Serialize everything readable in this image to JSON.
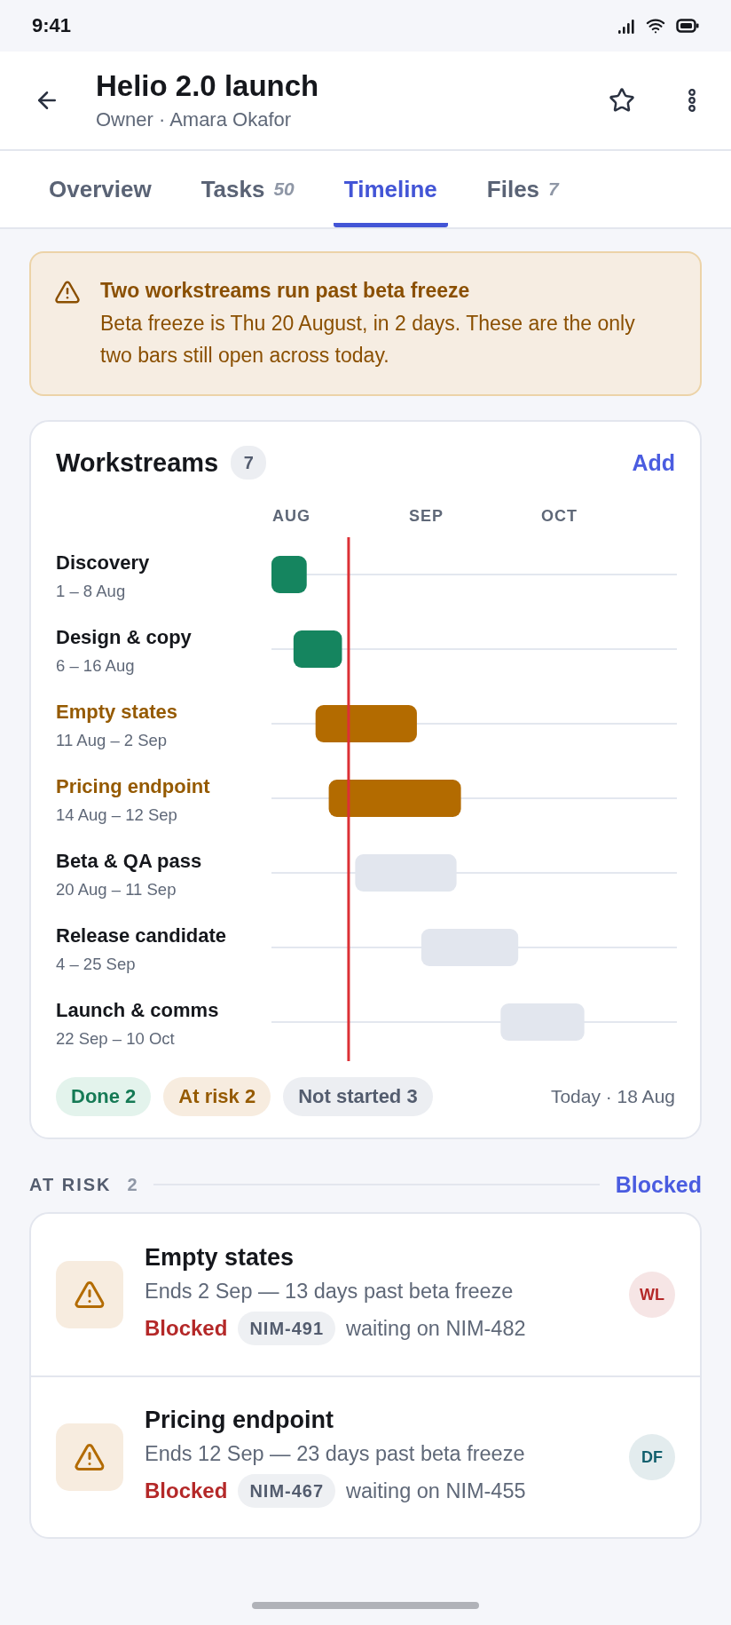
{
  "status_bar": {
    "time": "9:41"
  },
  "header": {
    "title": "Helio 2.0 launch",
    "subtitle": "Owner · Amara Okafor"
  },
  "tabs": [
    {
      "label": "Overview",
      "selected": false
    },
    {
      "label": "Tasks",
      "count": "50",
      "selected": false
    },
    {
      "label": "Timeline",
      "selected": true
    },
    {
      "label": "Files",
      "count": "7",
      "selected": false
    }
  ],
  "alert": {
    "title": "Two workstreams run past beta freeze",
    "body": "Beta freeze is Thu 20 August, in 2 days. These are the only two bars still open across today."
  },
  "workstreams": {
    "title": "Workstreams",
    "count": "7",
    "action": "Add",
    "months": [
      "AUG",
      "SEP",
      "OCT"
    ],
    "rows": [
      {
        "name": "Discovery",
        "range": "1 – 8 Aug",
        "kind": "done"
      },
      {
        "name": "Design & copy",
        "range": "6 – 16 Aug",
        "kind": "done"
      },
      {
        "name": "Empty states",
        "range": "11 Aug – 2 Sep",
        "kind": "at_risk"
      },
      {
        "name": "Pricing endpoint",
        "range": "14 Aug – 12 Sep",
        "kind": "at_risk"
      },
      {
        "name": "Beta & QA pass",
        "range": "20 Aug – 11 Sep",
        "kind": "not_started"
      },
      {
        "name": "Release candidate",
        "range": "4 – 25 Sep",
        "kind": "not_started"
      },
      {
        "name": "Launch & comms",
        "range": "22 Sep – 10 Oct",
        "kind": "not_started"
      }
    ],
    "legend": [
      {
        "label": "Done 2",
        "kind": "done"
      },
      {
        "label": "At risk 2",
        "kind": "at_risk"
      },
      {
        "label": "Not started 3",
        "kind": "not_started"
      }
    ],
    "today": "Today · 18 Aug"
  },
  "at_risk": {
    "title": "AT RISK",
    "count": "2",
    "action": "Blocked",
    "items": [
      {
        "title": "Empty states",
        "detail": "Ends 2 Sep — 13 days past beta freeze",
        "status": "Blocked",
        "ticket": "NIM-491",
        "note": "waiting on NIM-482",
        "initials": "WL",
        "color": "#b42828"
      },
      {
        "title": "Pricing endpoint",
        "detail": "Ends 12 Sep — 23 days past beta freeze",
        "status": "Blocked",
        "ticket": "NIM-467",
        "note": "waiting on NIM-455",
        "initials": "DF",
        "color": "#12606e"
      }
    ]
  }
}
